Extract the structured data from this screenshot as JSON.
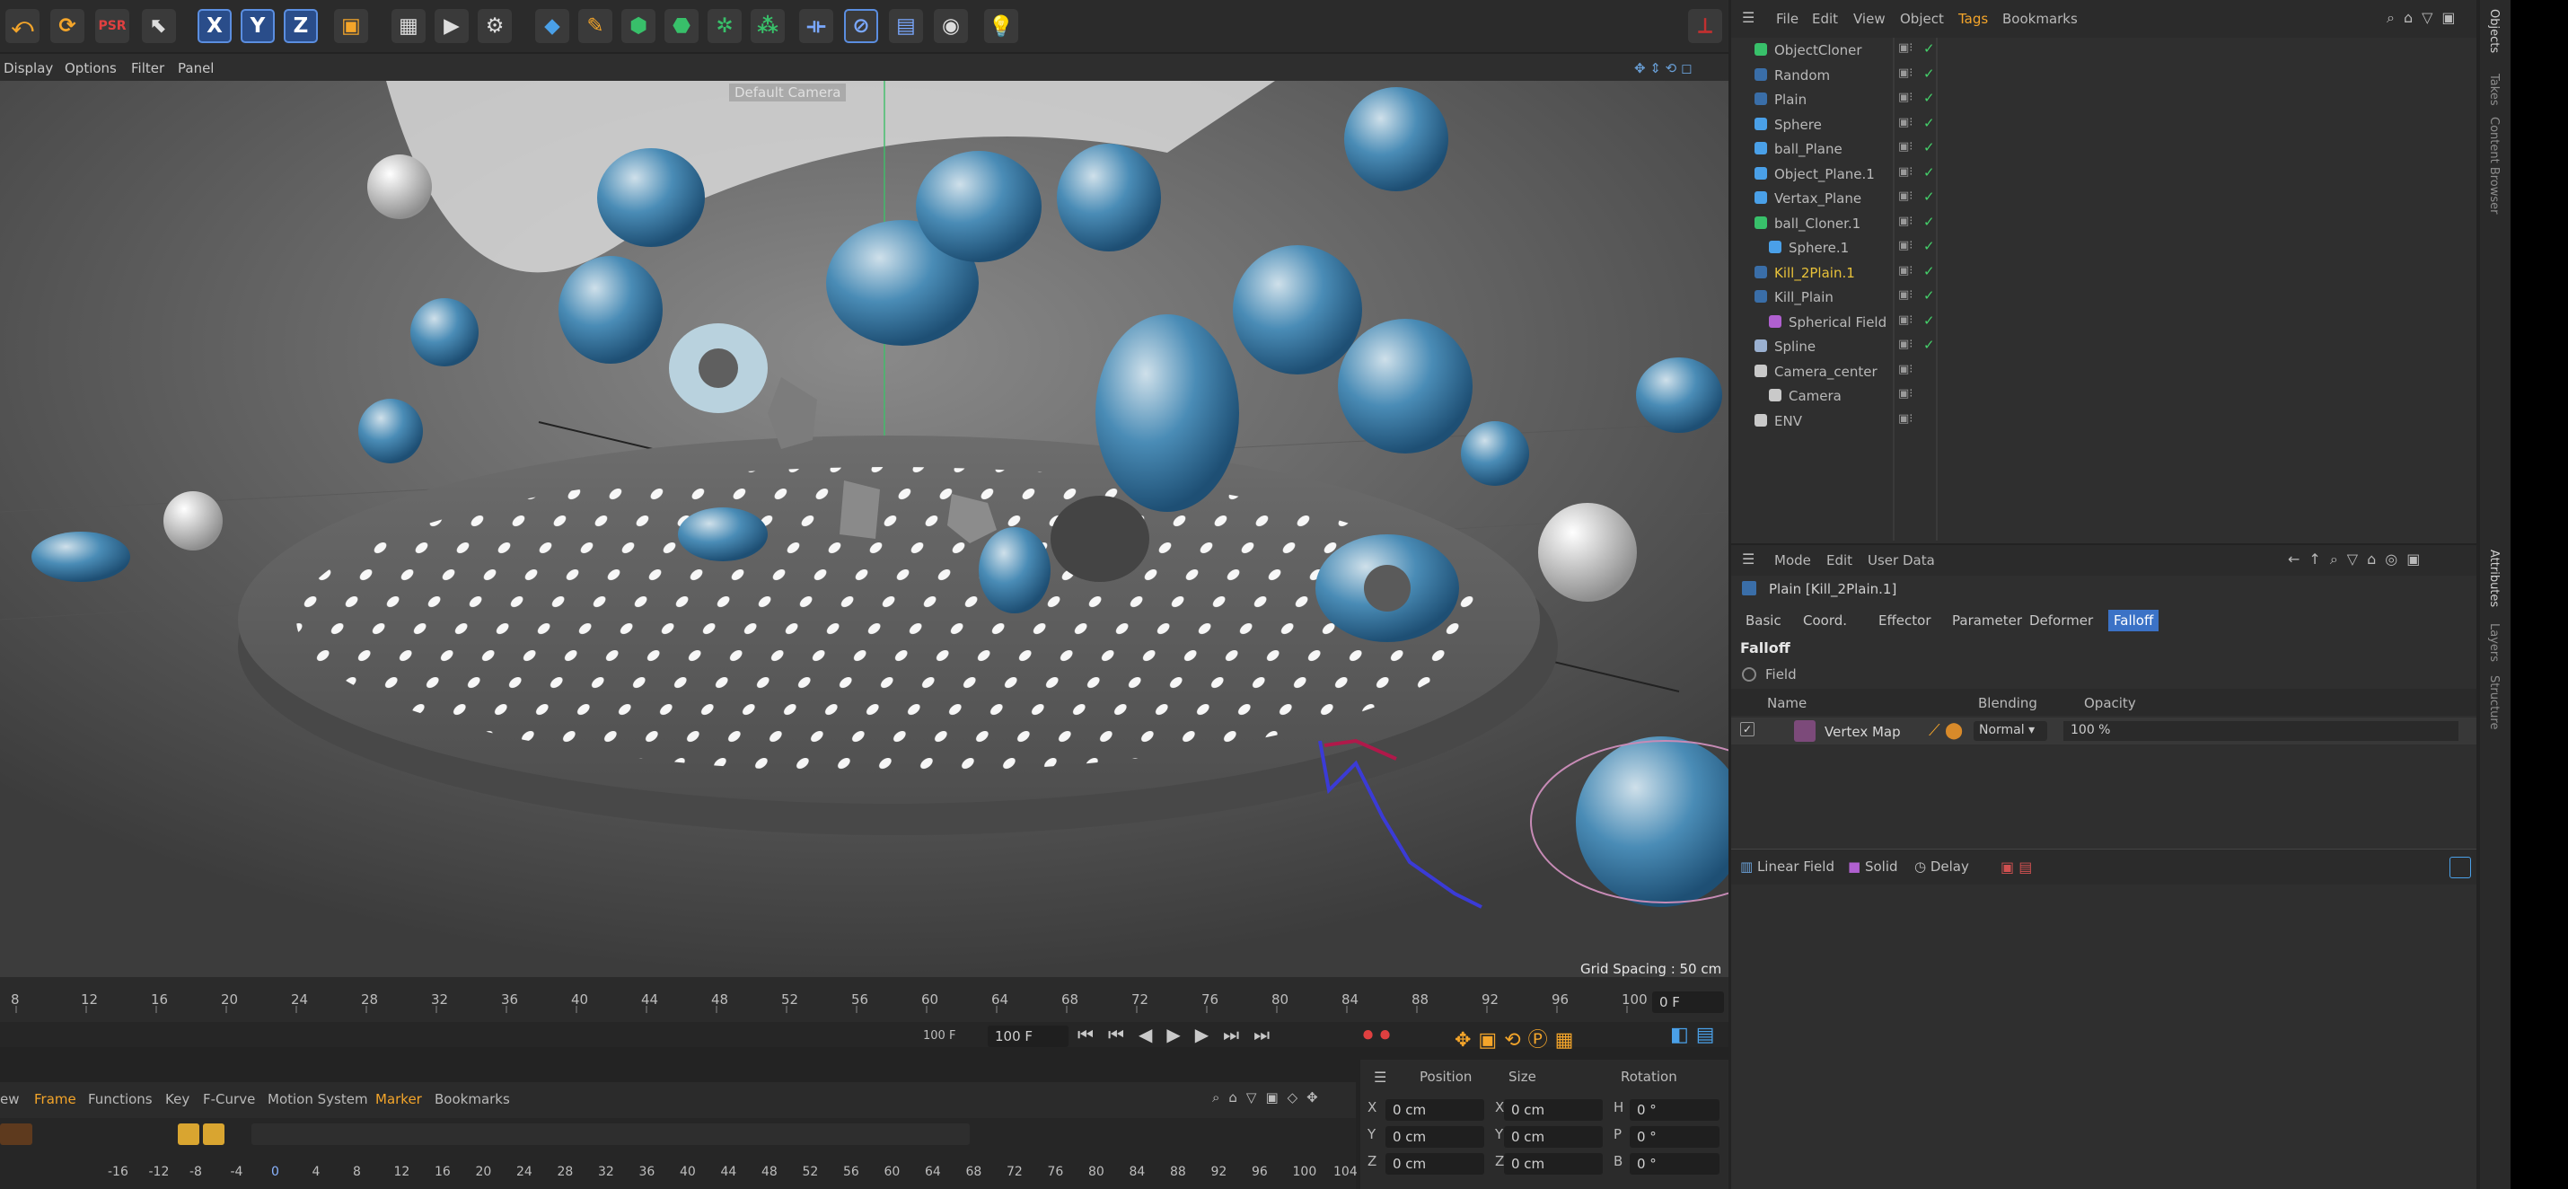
{
  "toolbar": {
    "x": "X",
    "y": "Y",
    "z": "Z"
  },
  "viewport": {
    "menu": [
      "Display",
      "Options",
      "Filter",
      "Panel"
    ],
    "camera_label": "Default Camera",
    "grid_spacing": "Grid Spacing : 50 cm"
  },
  "timeline": {
    "ticks": [
      "8",
      "12",
      "16",
      "20",
      "24",
      "28",
      "32",
      "36",
      "40",
      "44",
      "48",
      "52",
      "56",
      "60",
      "64",
      "68",
      "72",
      "76",
      "80",
      "84",
      "88",
      "92",
      "96",
      "100"
    ],
    "current_frame": "0 F",
    "end_frame_a": "100 F",
    "end_frame_b": "100 F"
  },
  "fcurve": {
    "menu": [
      "ew",
      "Frame",
      "Functions",
      "Key",
      "F-Curve",
      "Motion System",
      "Marker",
      "Bookmarks"
    ],
    "ticks": [
      "-16",
      "-12",
      "-8",
      "-4",
      "0",
      "4",
      "8",
      "12",
      "16",
      "20",
      "24",
      "28",
      "32",
      "36",
      "40",
      "44",
      "48",
      "52",
      "56",
      "60",
      "64",
      "68",
      "72",
      "76",
      "80",
      "84",
      "88",
      "92",
      "96",
      "100",
      "104"
    ]
  },
  "coords": {
    "headers": [
      "Position",
      "Size",
      "Rotation"
    ],
    "rows": [
      {
        "axis": "X",
        "pos": "0 cm",
        "s_axis": "X",
        "size": "0 cm",
        "r_axis": "H",
        "rot": "0 °"
      },
      {
        "axis": "Y",
        "pos": "0 cm",
        "s_axis": "Y",
        "size": "0 cm",
        "r_axis": "P",
        "rot": "0 °"
      },
      {
        "axis": "Z",
        "pos": "0 cm",
        "s_axis": "Z",
        "size": "0 cm",
        "r_axis": "B",
        "rot": "0 °"
      }
    ]
  },
  "objects": {
    "menu": [
      "File",
      "Edit",
      "View",
      "Object",
      "Tags",
      "Bookmarks"
    ],
    "items": [
      {
        "name": "ObjectCloner",
        "icon": "cloner-icon"
      },
      {
        "name": "Random",
        "icon": "random-effector-icon"
      },
      {
        "name": "Plain",
        "icon": "plain-effector-icon"
      },
      {
        "name": "Sphere",
        "icon": "sphere-icon"
      },
      {
        "name": "ball_Plane",
        "icon": "plane-icon"
      },
      {
        "name": "Object_Plane.1",
        "icon": "plane-icon"
      },
      {
        "name": "Vertax_Plane",
        "icon": "plane-icon"
      },
      {
        "name": "ball_Cloner.1",
        "icon": "cloner-icon"
      },
      {
        "name": "Sphere.1",
        "icon": "sphere-icon"
      },
      {
        "name": "Kill_2Plain.1",
        "icon": "plain-effector-icon"
      },
      {
        "name": "Kill_Plain",
        "icon": "plain-effector-icon"
      },
      {
        "name": "Spherical Field",
        "icon": "spherical-field-icon"
      },
      {
        "name": "Spline",
        "icon": "spline-icon"
      },
      {
        "name": "Camera_center",
        "icon": "null-icon"
      },
      {
        "name": "Camera",
        "icon": "camera-icon"
      },
      {
        "name": "ENV",
        "icon": "null-icon"
      }
    ]
  },
  "side_tabs": {
    "top": [
      "Objects",
      "Takes",
      "Content Browser"
    ],
    "bottom": [
      "Attributes",
      "Layers",
      "Structure"
    ]
  },
  "attributes": {
    "menu": [
      "Mode",
      "Edit",
      "User Data"
    ],
    "object_title": "Plain [Kill_2Plain.1]",
    "tabs": [
      "Basic",
      "Coord.",
      "Effector",
      "Parameter",
      "Deformer",
      "Falloff"
    ],
    "active_tab": "Falloff",
    "section": "Falloff",
    "field_label": "Field",
    "table_headers": [
      "Name",
      "Blending",
      "Opacity"
    ],
    "layer": {
      "name": "Vertex Map",
      "blending": "Normal",
      "opacity": "100 %"
    },
    "field_buttons": [
      "Linear Field",
      "Solid",
      "Delay"
    ]
  },
  "colors": {
    "active_tab": "#3b72c6",
    "highlight_name": "#e8c23a",
    "accent": "#3a6ea8"
  }
}
